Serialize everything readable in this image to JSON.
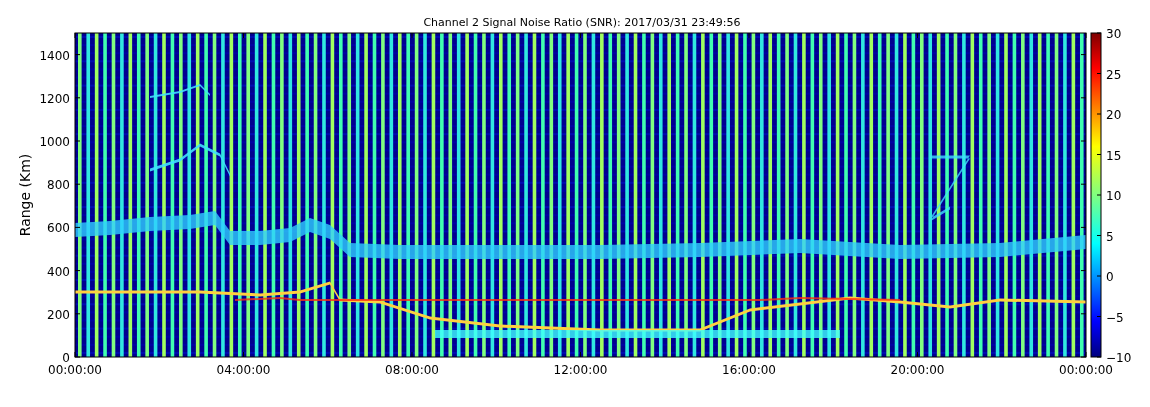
{
  "title": "Channel 2 Signal Noise Ratio (SNR): 2017/03/31 23:49:56",
  "y_axis": {
    "label": "Range (Km)",
    "ticks": [
      "1400",
      "1200",
      "1000",
      "800",
      "600",
      "400",
      "200",
      "0"
    ]
  },
  "x_axis": {
    "ticks": [
      "00:00:00",
      "04:00:00",
      "08:00:00",
      "12:00:00",
      "16:00:00",
      "20:00:00",
      "00:00:00"
    ]
  },
  "colorbar": {
    "ticks": [
      "30",
      "25",
      "20",
      "15",
      "10",
      "5",
      "0",
      "−5",
      "−10"
    ]
  }
}
